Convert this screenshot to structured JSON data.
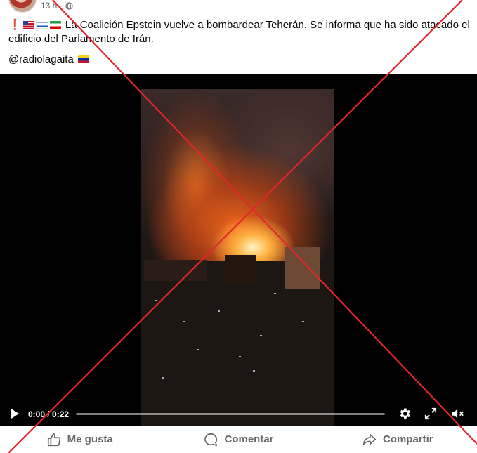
{
  "post": {
    "timestamp": "13 h ·",
    "text_line1": "La Coalición Epstein vuelve a bombardear Teherán. Se informa que ha sido atacado el",
    "text_line2": "edificio del Parlamento de Irán.",
    "handle": "@radiolagaita"
  },
  "video": {
    "time_display": "0:00 / 0:22",
    "progress_fraction": 0.0
  },
  "actions": {
    "like_label": "Me gusta",
    "comment_label": "Comentar",
    "share_label": "Compartir"
  },
  "icons": {
    "globe": "globe-icon",
    "play": "play-icon",
    "settings": "gear-icon",
    "fullscreen": "fullscreen-icon",
    "mute": "mute-icon",
    "like": "thumbs-up-icon",
    "comment": "comment-icon",
    "share": "share-icon"
  },
  "colors": {
    "overlay_cross": "#e3262b",
    "secondary_text": "#65676b",
    "video_bg": "#000000"
  }
}
